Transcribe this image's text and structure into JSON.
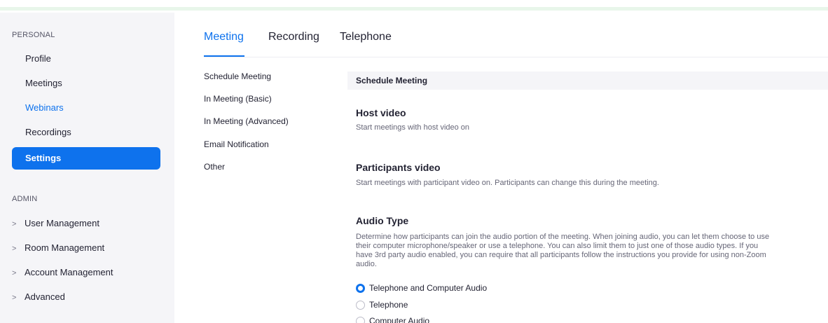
{
  "sidebar": {
    "personal_label": "PERSONAL",
    "personal_items": [
      {
        "label": "Profile"
      },
      {
        "label": "Meetings"
      },
      {
        "label": "Webinars"
      },
      {
        "label": "Recordings"
      },
      {
        "label": "Settings"
      }
    ],
    "admin_label": "ADMIN",
    "admin_items": [
      {
        "label": "User Management"
      },
      {
        "label": "Room Management"
      },
      {
        "label": "Account Management"
      },
      {
        "label": "Advanced"
      }
    ],
    "chevron_glyph": ">"
  },
  "tabs": [
    {
      "label": "Meeting"
    },
    {
      "label": "Recording"
    },
    {
      "label": "Telephone"
    }
  ],
  "subnav": [
    {
      "label": "Schedule Meeting"
    },
    {
      "label": "In Meeting (Basic)"
    },
    {
      "label": "In Meeting (Advanced)"
    },
    {
      "label": "Email Notification"
    },
    {
      "label": "Other"
    }
  ],
  "content": {
    "section_header": "Schedule Meeting",
    "host_video": {
      "title": "Host video",
      "desc": "Start meetings with host video on"
    },
    "participants_video": {
      "title": "Participants video",
      "desc": "Start meetings with participant video on. Participants can change this during the meeting."
    },
    "audio_type": {
      "title": "Audio Type",
      "desc": "Determine how participants can join the audio portion of the meeting. When joining audio, you can let them choose to use their computer microphone/speaker or use a telephone. You can also limit them to just one of those audio types. If you have 3rd party audio enabled, you can require that all participants follow the instructions you provide for using non-Zoom audio.",
      "options": [
        {
          "label": "Telephone and Computer Audio"
        },
        {
          "label": "Telephone"
        },
        {
          "label": "Computer Audio"
        }
      ],
      "selected": "Telephone and Computer Audio"
    }
  },
  "colors": {
    "accent": "#0e72ed",
    "sidebar_bg": "#f5f5f8",
    "top_strip": "#e8f6ea"
  }
}
